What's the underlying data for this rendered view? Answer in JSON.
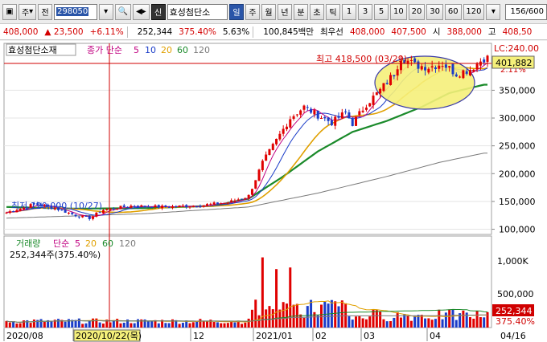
{
  "toolbar": {
    "type_label": "주",
    "prev_label": "전",
    "code": "298050",
    "stock_name": "효성첨단소",
    "period_buttons": [
      "일",
      "주",
      "월",
      "년",
      "분",
      "초",
      "틱"
    ],
    "numeric_buttons": [
      "1",
      "3",
      "5",
      "10",
      "20",
      "30",
      "60",
      "120"
    ],
    "active_period": "일",
    "count": "156",
    "count_total": "/600"
  },
  "pricebar": {
    "price": "408,000",
    "change": "▲ 23,500",
    "change_pct": "+6.11%",
    "volume": "252,344",
    "volume_ratio": "375.40%",
    "turnover": "5.63%",
    "amount": "100,845백만",
    "best_ask_label": "최우선",
    "best_ask": "408,000",
    "best_bid": "407,500",
    "start_label": "시",
    "start": "388,000",
    "high_label": "고",
    "high": "408,50"
  },
  "legend": {
    "stock_name": "효성첨단소재",
    "ma_label": "종가 단순",
    "ma_periods": [
      "5",
      "10",
      "20",
      "60",
      "120"
    ],
    "vol_label": "거래량",
    "vol_ma_label": "단순",
    "vol_summary": "252,344주(375.40%)"
  },
  "annotations": {
    "high": "최고 418,500 (03/29)",
    "low": "최저 120,000 (10/27)",
    "lc": "LC:240.00",
    "lc_sub": "2.11%",
    "crosshair_date": "2020/10/22(목)",
    "current_price": "401,882",
    "current_volume": "252,344",
    "volume_ratio_label": "375.40%"
  },
  "colors": {
    "up": "#e00000",
    "down": "#1a3cc8",
    "ma5": "#c00080",
    "ma10": "#1a3cc8",
    "ma20": "#e0a000",
    "ma60": "#1a8a2a",
    "ma120": "#7a7a7a",
    "crosshair": "#d00000",
    "highlight": "#f5f07a"
  },
  "chart_data": {
    "type": "candlestick",
    "x_ticks": [
      "2020/08",
      "2020/10/22(목)",
      "12",
      "2021/01",
      "02",
      "03",
      "04",
      "04/16"
    ],
    "price_ylim": [
      95000,
      430000
    ],
    "price_ticks": [
      100000,
      150000,
      200000,
      250000,
      300000,
      350000
    ],
    "volume_ticks_labels": [
      "500,000",
      "1,000K"
    ],
    "volume_ylim": [
      0,
      1300000
    ],
    "price_path": [
      [
        0,
        130000
      ],
      [
        8,
        145000
      ],
      [
        14,
        138000
      ],
      [
        20,
        125000
      ],
      [
        24,
        120000
      ],
      [
        28,
        135000
      ],
      [
        36,
        142000
      ],
      [
        46,
        140000
      ],
      [
        56,
        143000
      ],
      [
        64,
        148000
      ],
      [
        70,
        160000
      ],
      [
        74,
        220000
      ],
      [
        78,
        260000
      ],
      [
        82,
        300000
      ],
      [
        86,
        320000
      ],
      [
        90,
        305000
      ],
      [
        94,
        292000
      ],
      [
        98,
        310000
      ],
      [
        100,
        290000
      ],
      [
        104,
        325000
      ],
      [
        108,
        350000
      ],
      [
        112,
        380000
      ],
      [
        114,
        410000
      ],
      [
        118,
        395000
      ],
      [
        122,
        392000
      ],
      [
        126,
        398000
      ],
      [
        130,
        380000
      ],
      [
        134,
        388000
      ],
      [
        138,
        408000
      ]
    ],
    "ma_lines": {
      "ma60": [
        [
          0,
          140000
        ],
        [
          20,
          137000
        ],
        [
          40,
          138000
        ],
        [
          60,
          142000
        ],
        [
          70,
          155000
        ],
        [
          80,
          195000
        ],
        [
          90,
          240000
        ],
        [
          100,
          275000
        ],
        [
          110,
          295000
        ],
        [
          120,
          320000
        ],
        [
          128,
          345000
        ],
        [
          138,
          360000
        ]
      ],
      "ma120": [
        [
          0,
          120000
        ],
        [
          40,
          128000
        ],
        [
          70,
          140000
        ],
        [
          90,
          165000
        ],
        [
          110,
          195000
        ],
        [
          125,
          220000
        ],
        [
          138,
          237000
        ]
      ]
    }
  }
}
